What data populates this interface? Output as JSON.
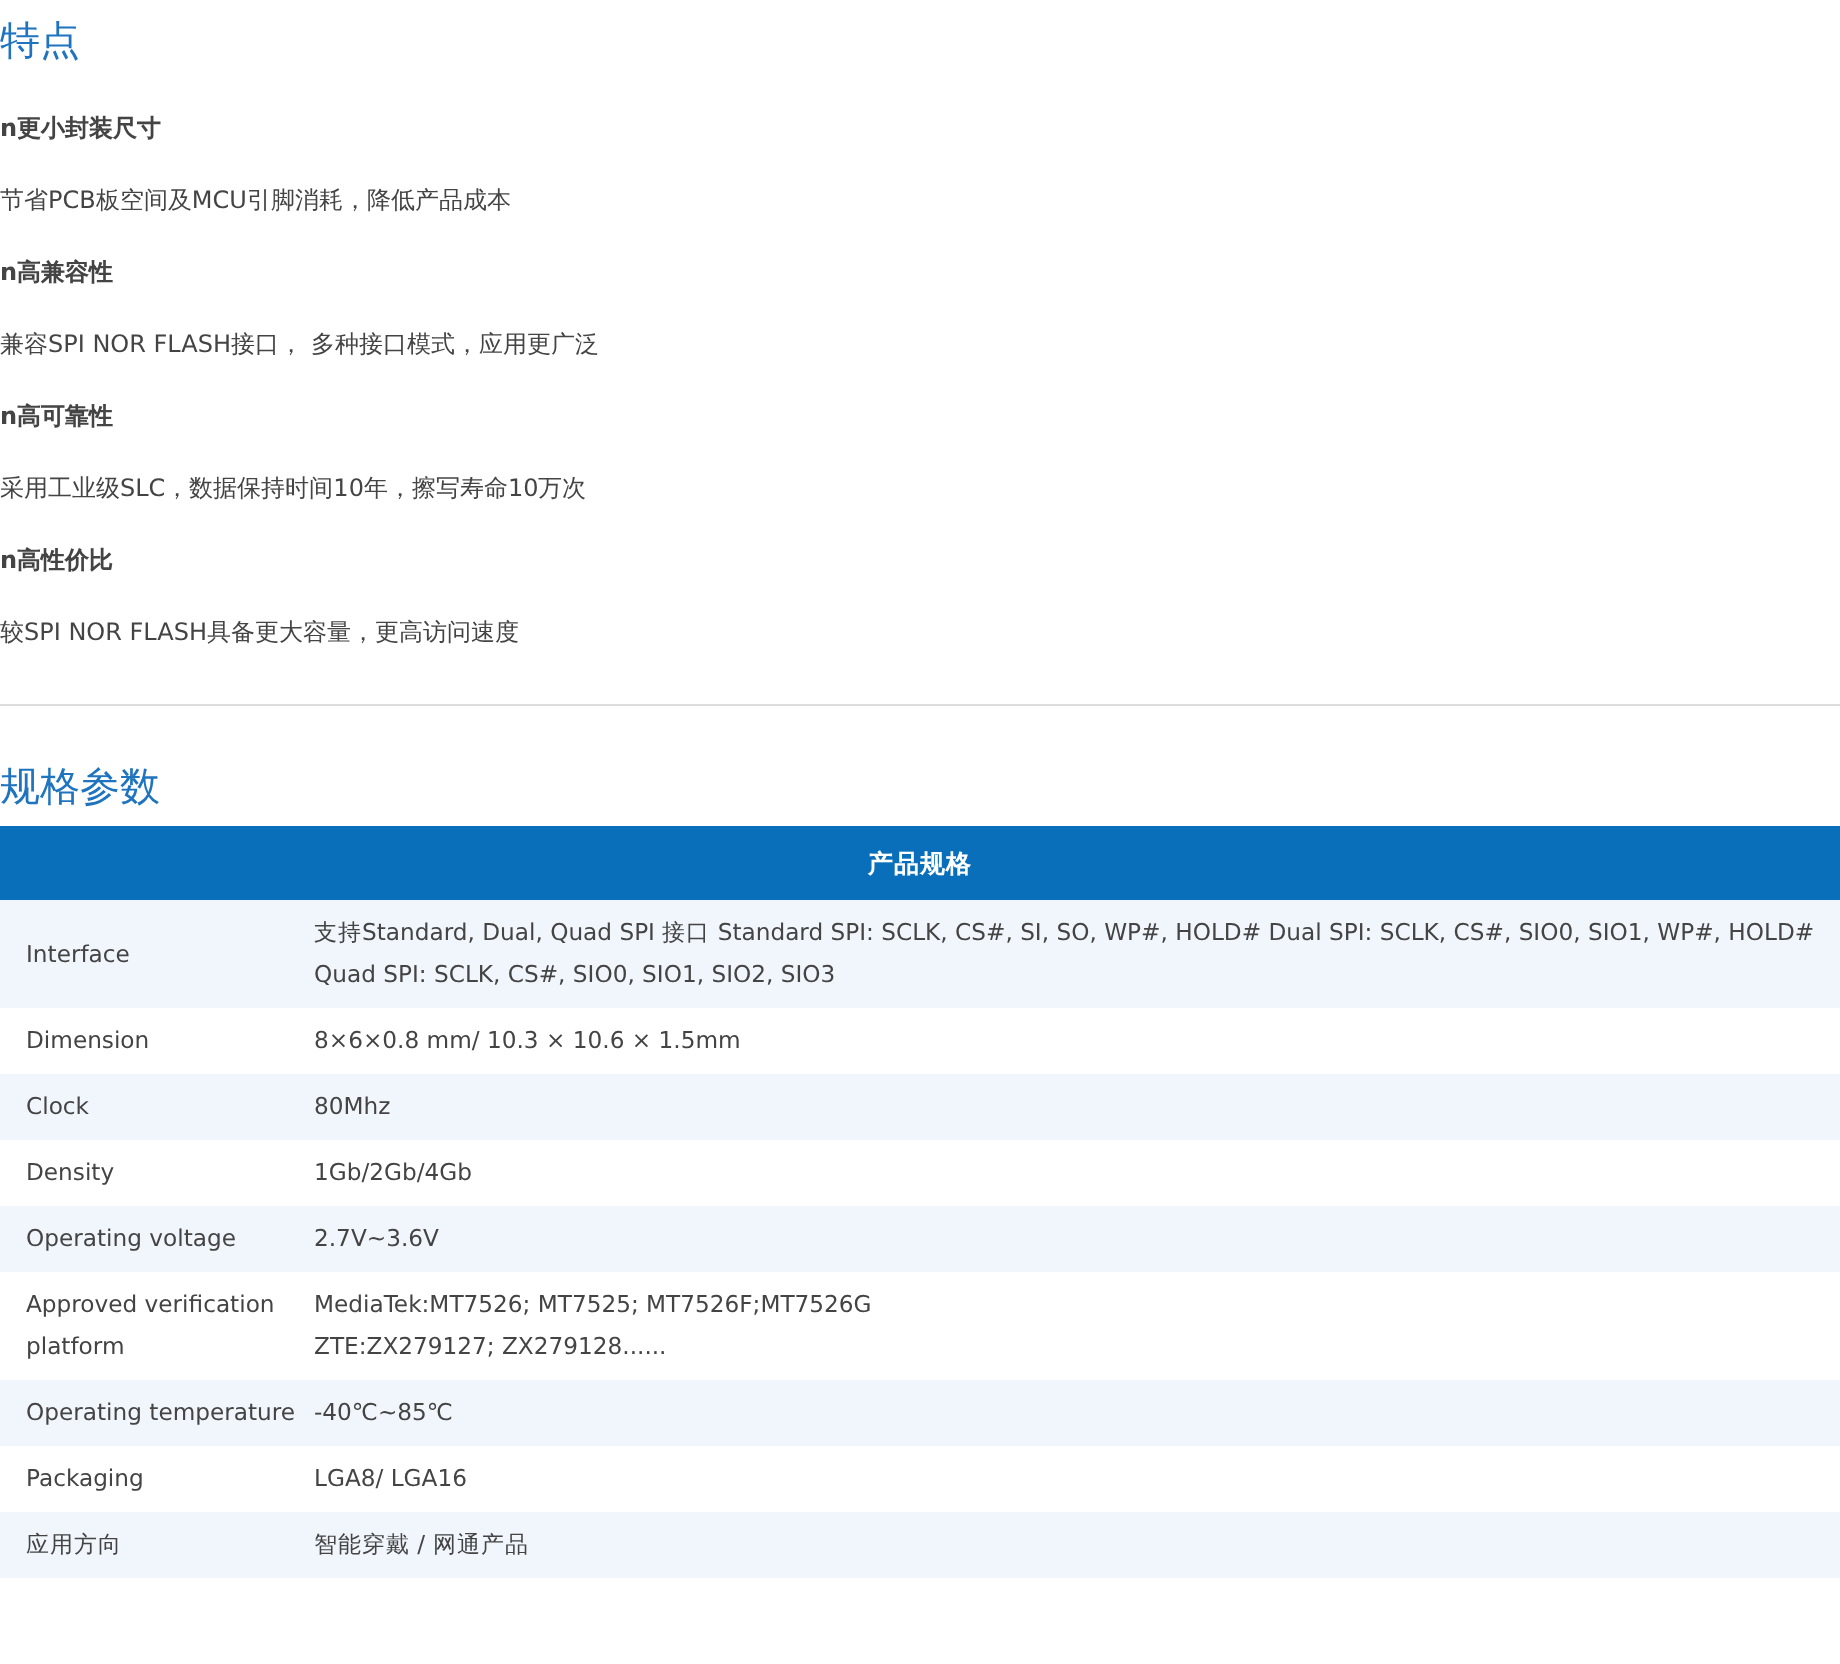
{
  "features": {
    "title": "特点",
    "items": [
      {
        "heading": "n更小封装尺寸",
        "text": "节省PCB板空间及MCU引脚消耗，降低产品成本"
      },
      {
        "heading": "n高兼容性",
        "text": "兼容SPI NOR FLASH接口， 多种接口模式，应用更广泛"
      },
      {
        "heading": "n高可靠性",
        "text": "采用工业级SLC，数据保持时间10年，擦写寿命10万次"
      },
      {
        "heading": "n高性价比",
        "text": "较SPI NOR FLASH具备更大容量，更高访问速度"
      }
    ]
  },
  "specs": {
    "title": "规格参数",
    "table": {
      "header": "产品规格",
      "rows": [
        {
          "label": "Interface",
          "value": [
            "支持Standard, Dual, Quad SPI 接口 Standard SPI: SCLK, CS#, SI, SO, WP#, HOLD# Dual SPI: SCLK, CS#, SIO0, SIO1, WP#, HOLD# Quad SPI: SCLK, CS#, SIO0, SIO1, SIO2, SIO3"
          ]
        },
        {
          "label": "Dimension",
          "value": [
            "8×6×0.8 mm/ 10.3 × 10.6 × 1.5mm"
          ]
        },
        {
          "label": "Clock",
          "value": [
            "80Mhz"
          ]
        },
        {
          "label": "Density",
          "value": [
            "1Gb/2Gb/4Gb"
          ]
        },
        {
          "label": "Operating voltage",
          "value": [
            "2.7V~3.6V"
          ]
        },
        {
          "label": "Approved verification platform",
          "value": [
            "MediaTek:MT7526; MT7525; MT7526F;MT7526G",
            "ZTE:ZX279127; ZX279128......"
          ]
        },
        {
          "label": "Operating temperature",
          "value": [
            "-40℃~85℃"
          ]
        },
        {
          "label": "Packaging",
          "value": [
            "LGA8/ LGA16"
          ]
        },
        {
          "label": "应用方向",
          "value": [
            "智能穿戴 / 网通产品"
          ]
        }
      ]
    }
  }
}
